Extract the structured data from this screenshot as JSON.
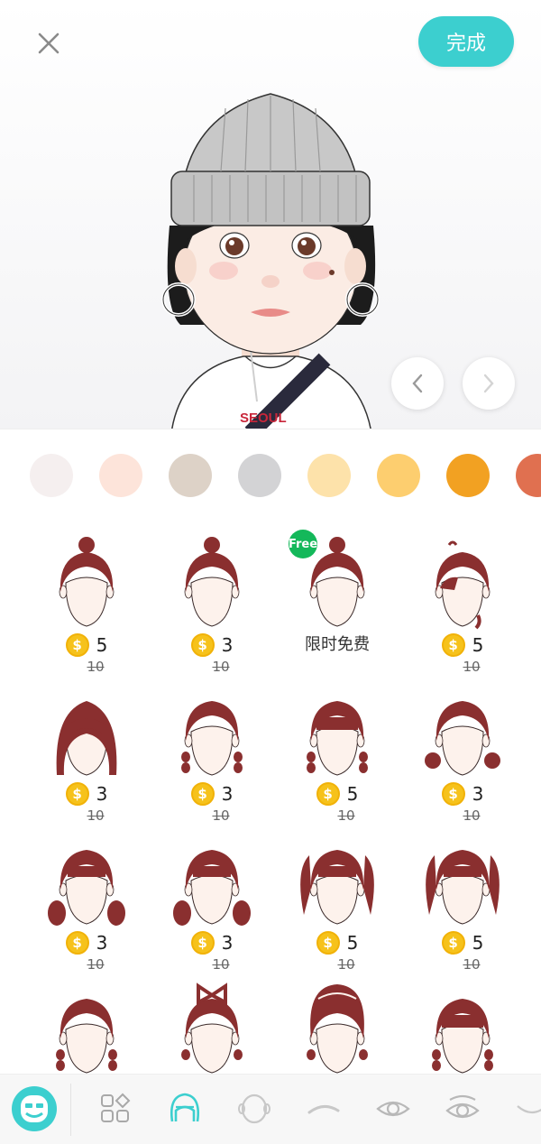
{
  "header": {
    "close_icon": "close-icon",
    "done_label": "完成"
  },
  "preview": {
    "shirt_text": "SEOUL",
    "prev_icon": "chevron-left-icon",
    "next_icon": "chevron-right-icon"
  },
  "colors": {
    "accent": "#3ccfcf",
    "hair": "#8a2f2f",
    "coin": "#f6c21b",
    "free_badge": "#14b85a"
  },
  "swatches": [
    "#f5efef",
    "#fde4da",
    "#ddd2c7",
    "#d3d3d5",
    "#fde2aa",
    "#fdce6f",
    "#f2a122",
    "#e07050"
  ],
  "hairstyles": [
    {
      "variant": "bun",
      "price": "5",
      "old_price": "10"
    },
    {
      "variant": "bun",
      "price": "3",
      "old_price": "10"
    },
    {
      "variant": "bun",
      "free": true,
      "badge": "Free",
      "label": "限时免费"
    },
    {
      "variant": "short",
      "price": "5",
      "old_price": "10"
    },
    {
      "variant": "bangs-long",
      "price": "3",
      "old_price": "10"
    },
    {
      "variant": "braids",
      "price": "3",
      "old_price": "10"
    },
    {
      "variant": "braids-bangs",
      "price": "5",
      "old_price": "10"
    },
    {
      "variant": "side-buns",
      "price": "3",
      "old_price": "10"
    },
    {
      "variant": "low-pigtails",
      "price": "3",
      "old_price": "10"
    },
    {
      "variant": "low-pigtails",
      "price": "3",
      "old_price": "10"
    },
    {
      "variant": "twintails",
      "price": "5",
      "old_price": "10"
    },
    {
      "variant": "twintails",
      "price": "5",
      "old_price": "10"
    },
    {
      "variant": "braids",
      "price": "",
      "old_price": ""
    },
    {
      "variant": "bow",
      "price": "",
      "old_price": ""
    },
    {
      "variant": "crown",
      "price": "",
      "old_price": ""
    },
    {
      "variant": "braids-bangs",
      "price": "",
      "old_price": ""
    }
  ],
  "toolbar": {
    "items": [
      "avatar-face-icon",
      "categories-icon",
      "hair-icon",
      "face-shape-icon",
      "eyebrow-icon",
      "eye-icon",
      "eye-color-icon",
      "mouth-icon"
    ]
  }
}
